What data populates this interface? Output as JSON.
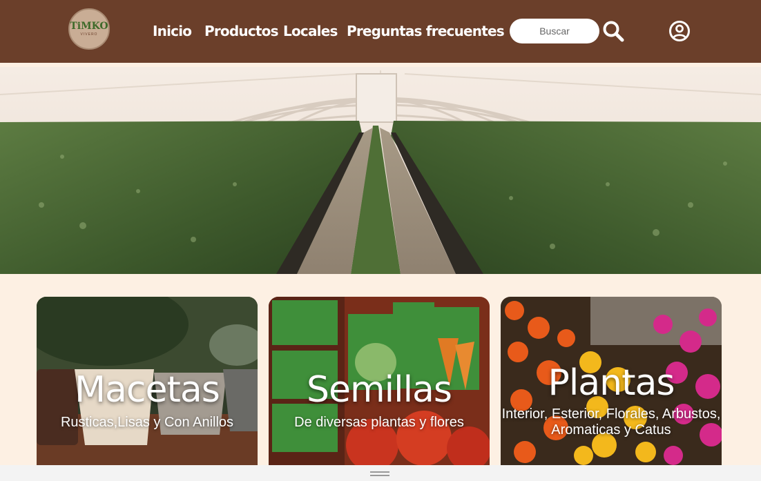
{
  "header": {
    "logo": {
      "text": "TiMKO",
      "sub": "VIVERO"
    },
    "nav": [
      {
        "label": "Inicio"
      },
      {
        "label": "Productos"
      },
      {
        "label": "Locales"
      },
      {
        "label": "Preguntas frecuentes"
      }
    ],
    "search": {
      "placeholder": "Buscar",
      "icon": "search-icon"
    },
    "user_icon": "user-circle-icon"
  },
  "hero": {
    "image": "greenhouse"
  },
  "categories": [
    {
      "title": "Macetas",
      "subtitle": "Rusticas,Lisas y Con Anillos"
    },
    {
      "title": "Semillas",
      "subtitle": "De diversas plantas y flores"
    },
    {
      "title": "Plantas",
      "subtitle_line1": "Interior, Esterior, Florales, Arbustos,",
      "subtitle_line2": "Aromaticas y Catus"
    }
  ],
  "colors": {
    "header_bg": "#6b3f2a",
    "page_bg": "#fdf0e3",
    "nav_text": "#ffffff"
  }
}
